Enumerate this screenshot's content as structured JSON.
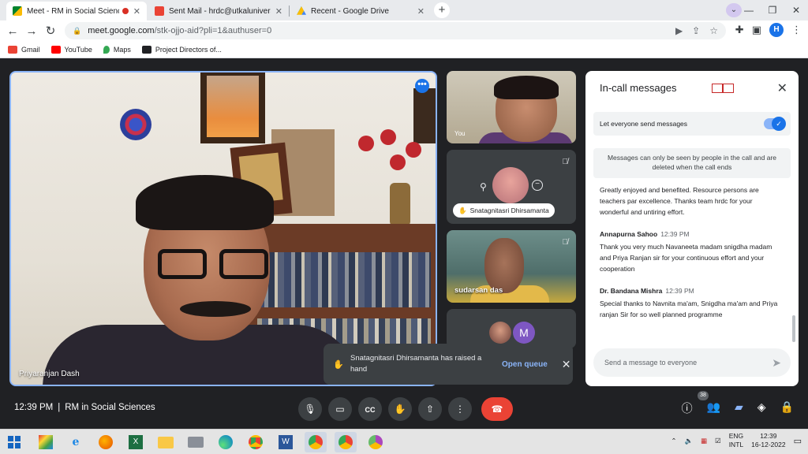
{
  "browser": {
    "tabs": [
      {
        "title": "Meet - RM in Social Sciences",
        "active": true,
        "favicon": "meet-icon"
      },
      {
        "title": "Sent Mail - hrdc@utkaluniversity",
        "active": false,
        "favicon": "gmail-icon"
      },
      {
        "title": "Recent - Google Drive",
        "active": false,
        "favicon": "drive-icon"
      }
    ],
    "url_host": "meet.google.com",
    "url_path": "/stk-ojjo-aid?pli=1&authuser=0",
    "profile_initial": "H",
    "bookmarks": [
      "Gmail",
      "YouTube",
      "Maps",
      "Project Directors of..."
    ]
  },
  "meet": {
    "main_tile_name": "Priyaranjan Dash",
    "self_label": "You",
    "raised_hand_participant": "Snatagnitasri Dhirsamanta",
    "tile3_name": "sudarsan das",
    "tile4_avatar_initial": "M",
    "toast": {
      "message": "Snatagnitasri Dhirsamanta has raised a hand",
      "action": "Open queue"
    },
    "time": "12:39 PM",
    "meeting_title": "RM in Social Sciences",
    "participant_count": "38"
  },
  "panel": {
    "title": "In-call messages",
    "toggle_label": "Let everyone send messages",
    "toggle_on": true,
    "info": "Messages can only be seen by people in the call and are deleted when the call ends",
    "messages": [
      {
        "sender": "",
        "time": "",
        "text": "Greatly enjoyed and benefited. Resource persons are teachers par excellence. Thanks team hrdc for your wonderful and untiring effort."
      },
      {
        "sender": "Annapurna Sahoo",
        "time": "12:39 PM",
        "text": "Thank you very much Navaneeta madam snigdha madam and Priya Ranjan sir for your continuous effort and your cooperation"
      },
      {
        "sender": "Dr. Bandana Mishra",
        "time": "12:39 PM",
        "text": "Special thanks to Navnita ma'am, Snigdha ma'am and Priya ranjan Sir for so well planned programme"
      }
    ],
    "send_placeholder": "Send a message to everyone"
  },
  "taskbar": {
    "lang_line1": "ENG",
    "lang_line2": "INTL",
    "clock_time": "12:39",
    "clock_date": "16-12-2022"
  },
  "colors": {
    "accent": "#1a73e8",
    "end_call": "#ea4335",
    "dark_bg": "#202124"
  }
}
